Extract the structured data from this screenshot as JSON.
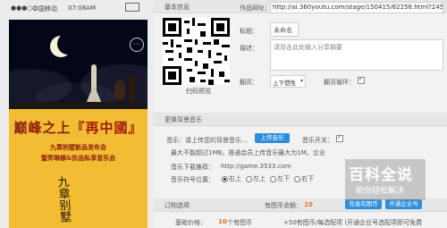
{
  "phone": {
    "carrier": "中国移动",
    "time": "07:08AM",
    "menu_icon": "dots-icon",
    "poster": {
      "title_main": "巅峰之上",
      "title_bracket": "『再中國』",
      "sub1": "九章别墅新品发布会",
      "sub2": "暨弄琳娜&优品私享音乐会",
      "logo_text": "九章别墅"
    }
  },
  "basic": {
    "header": "基本信息",
    "url_label": "作品网址：",
    "url_value": "http://ai.360youtu.com/stage/150415/62256.html?245",
    "qr_caption": "扫码预览",
    "title_label": "标题：",
    "title_value": "未命名",
    "desc_label": "描述：",
    "desc_placeholder": "请双击此处输入分享摘要",
    "flip_label": "翻页：",
    "flip_value": "上下惯性",
    "loop_label": "翻页循环："
  },
  "music": {
    "header": "更换背景音乐",
    "label": "音乐：请上传您的背景音乐...",
    "upload_button": "上传音乐",
    "switch_label": "音乐开关：",
    "note": "最大不能超过1MB，普通会员上传音乐最大为1M，企业",
    "download_label": "音乐下载推荐：",
    "download_value": "http://game.3533.com",
    "pos_label": "音乐符号位置：",
    "positions": [
      "右上",
      "左上",
      "左下",
      "右下"
    ],
    "selected_position": "右上"
  },
  "order": {
    "header": "订购选项",
    "coins_label": "有图币余额：",
    "coins_value": "10",
    "recharge_button": "充值有图币",
    "vip_button": "开通企业号",
    "price_label": "基础价格：",
    "price_value": "10",
    "price_unit": "个有图币",
    "extra_text": "+50有图币/每选配项 (开通企业号选配项即可免费"
  },
  "watermark": {
    "main": "百科全说",
    "sub": "助你轻松解决"
  },
  "colors": {
    "accent": "#2f8fdc",
    "poster_gold": "#f2bd32",
    "poster_red": "#8b1c0f",
    "night": "#04061a",
    "price_orange": "#e8740c"
  }
}
